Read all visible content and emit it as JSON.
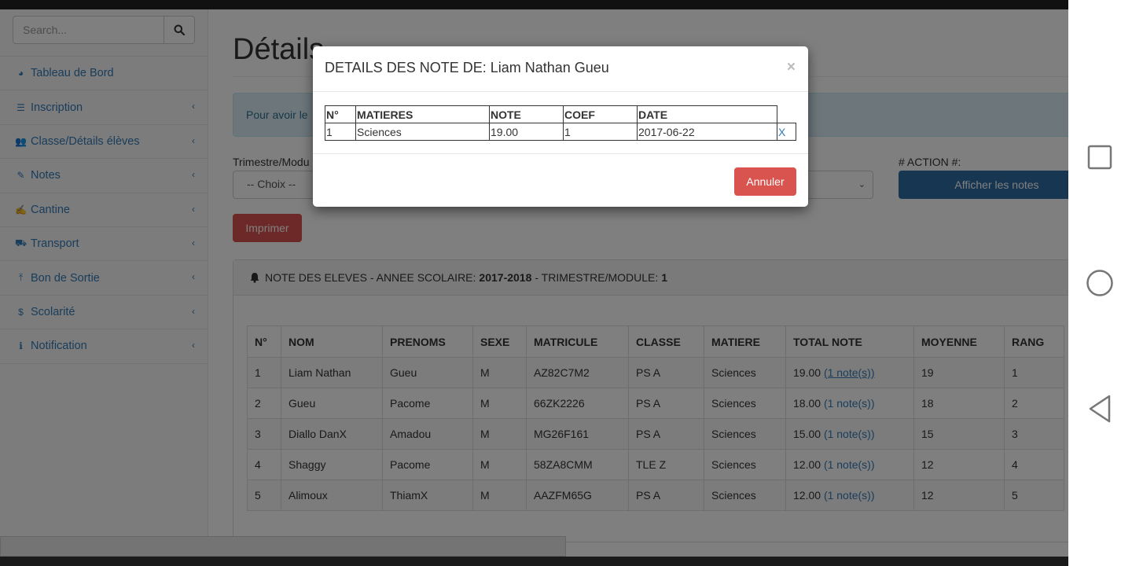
{
  "sidebar": {
    "search_placeholder": "Search...",
    "items": [
      {
        "label": "Tableau de Bord",
        "icon": "dashboard-icon",
        "has_chevron": false
      },
      {
        "label": "Inscription",
        "icon": "list-icon",
        "has_chevron": true
      },
      {
        "label": "Classe/Détails élèves",
        "icon": "users-icon",
        "has_chevron": true
      },
      {
        "label": "Notes",
        "icon": "pencil-icon",
        "has_chevron": true
      },
      {
        "label": "Cantine",
        "icon": "edit-icon",
        "has_chevron": true
      },
      {
        "label": "Transport",
        "icon": "car-icon",
        "has_chevron": true
      },
      {
        "label": "Bon de Sortie",
        "icon": "upload-icon",
        "has_chevron": true
      },
      {
        "label": "Scolarité",
        "icon": "dollar-icon",
        "has_chevron": true
      },
      {
        "label": "Notification",
        "icon": "info-icon",
        "has_chevron": true
      }
    ]
  },
  "main": {
    "title": "Détails",
    "alert": "Pour avoir le",
    "filter_label": "Trimestre/Modu",
    "filter_value": "-- Choix --",
    "action_label": "# ACTION #:",
    "show_button": "Afficher les notes",
    "print_button": "Imprimer",
    "panel": {
      "prefix": "NOTE DES ELEVES - ANNEE SCOLAIRE:",
      "year": "2017-2018",
      "mid": "- TRIMESTRE/MODULE:",
      "trimester": "1"
    },
    "table": {
      "headers": [
        "N°",
        "NOM",
        "PRENOMS",
        "SEXE",
        "MATRICULE",
        "CLASSE",
        "MATIERE",
        "TOTAL NOTE",
        "MOYENNE",
        "RANG"
      ],
      "rows": [
        {
          "n": "1",
          "nom": "Liam Nathan",
          "prenoms": "Gueu",
          "sexe": "M",
          "matricule": "AZ82C7M2",
          "classe": "PS A",
          "matiere": "Sciences",
          "total": "19.00",
          "link": "(1 note(s))",
          "moyenne": "19",
          "rang": "1"
        },
        {
          "n": "2",
          "nom": "Gueu",
          "prenoms": "Pacome",
          "sexe": "M",
          "matricule": "66ZK2226",
          "classe": "PS A",
          "matiere": "Sciences",
          "total": "18.00",
          "link": "(1 note(s))",
          "moyenne": "18",
          "rang": "2"
        },
        {
          "n": "3",
          "nom": "Diallo DanX",
          "prenoms": "Amadou",
          "sexe": "M",
          "matricule": "MG26F161",
          "classe": "PS A",
          "matiere": "Sciences",
          "total": "15.00",
          "link": "(1 note(s))",
          "moyenne": "15",
          "rang": "3"
        },
        {
          "n": "4",
          "nom": "Shaggy",
          "prenoms": "Pacome",
          "sexe": "M",
          "matricule": "58ZA8CMM",
          "classe": "TLE Z",
          "matiere": "Sciences",
          "total": "12.00",
          "link": "(1 note(s))",
          "moyenne": "12",
          "rang": "4"
        },
        {
          "n": "5",
          "nom": "Alimoux",
          "prenoms": "ThiamX",
          "sexe": "M",
          "matricule": "AAZFM65G",
          "classe": "PS A",
          "matiere": "Sciences",
          "total": "12.00",
          "link": "(1 note(s))",
          "moyenne": "12",
          "rang": "5"
        }
      ]
    }
  },
  "modal": {
    "title": "DETAILS DES NOTE DE: Liam Nathan Gueu",
    "close": "×",
    "headers": [
      "N°",
      "MATIERES",
      "NOTE",
      "COEF",
      "DATE"
    ],
    "row": {
      "n": "1",
      "matiere": "Sciences",
      "note": "19.00",
      "coef": "1",
      "date": "2017-06-22",
      "delete": "X"
    },
    "cancel_button": "Annuler"
  },
  "colors": {
    "primary": "#2e6da4",
    "danger": "#d9534f",
    "link": "#337ab7",
    "alert_bg": "#d9edf7"
  }
}
